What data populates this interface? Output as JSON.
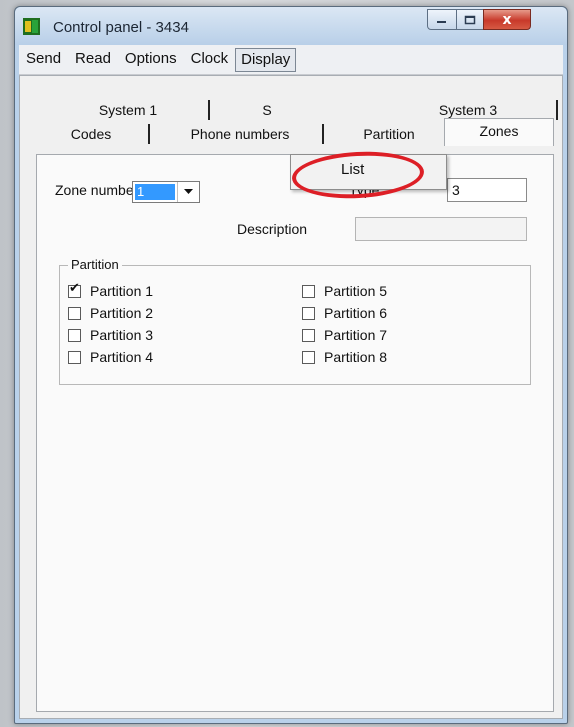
{
  "window": {
    "title": "Control panel - 3434",
    "close_label": "x"
  },
  "menu": [
    "Send",
    "Read",
    "Options",
    "Clock",
    "Display"
  ],
  "dropdown": {
    "items": [
      "List"
    ]
  },
  "tabs": {
    "back_row": [
      "System 1",
      "S",
      "System 3"
    ],
    "front_row": [
      "Codes",
      "Phone numbers",
      "Partition",
      "Zones"
    ]
  },
  "zones": {
    "zone_number_label": "Zone number",
    "zone_number_value": "1",
    "type_label": "Type",
    "type_value": "3",
    "description_label": "Description",
    "description_value": "",
    "partition_group_title": "Partition",
    "partitions": [
      {
        "label": "Partition 1",
        "checked": true
      },
      {
        "label": "Partition 2",
        "checked": false
      },
      {
        "label": "Partition 3",
        "checked": false
      },
      {
        "label": "Partition 4",
        "checked": false
      },
      {
        "label": "Partition 5",
        "checked": false
      },
      {
        "label": "Partition 6",
        "checked": false
      },
      {
        "label": "Partition 7",
        "checked": false
      },
      {
        "label": "Partition 8",
        "checked": false
      }
    ]
  },
  "colors": {
    "annotation_ring": "#dd1f26",
    "selection": "#3399ff"
  }
}
